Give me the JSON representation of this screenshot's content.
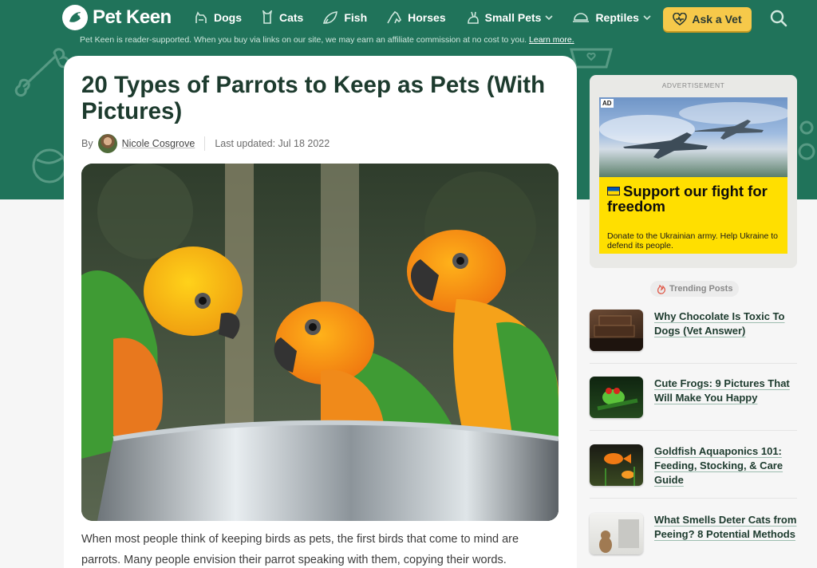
{
  "site": {
    "logo_text": "Pet Keen"
  },
  "nav": {
    "items": [
      {
        "label": "Dogs",
        "icon": "dog-icon"
      },
      {
        "label": "Cats",
        "icon": "cat-icon"
      },
      {
        "label": "Fish",
        "icon": "fish-icon"
      },
      {
        "label": "Horses",
        "icon": "horse-icon"
      },
      {
        "label": "Small Pets",
        "icon": "rabbit-icon",
        "dropdown": true
      },
      {
        "label": "Reptiles",
        "icon": "turtle-icon",
        "dropdown": true
      }
    ],
    "cta_label": "Ask a Vet"
  },
  "disclaimer": {
    "text": "Pet Keen is reader-supported. When you buy via links on our site, we may earn an affiliate commission at no cost to you.",
    "link": "Learn more."
  },
  "article": {
    "title": "20 Types of Parrots to Keep as Pets (With Pictures)",
    "by_label": "By",
    "author": "Nicole Cosgrove",
    "updated": "Last updated: Jul 18 2022",
    "intro": "When most people think of keeping birds as pets, the first birds that come to mind are parrots. Many people envision their parrot speaking with them, copying their words."
  },
  "ad": {
    "label": "ADVERTISEMENT",
    "tag": "AD",
    "headline": "Support our fight for freedom",
    "sub": "Donate to the Ukrainian army. Help Ukraine to defend its people."
  },
  "trending": {
    "label": "Trending Posts",
    "posts": [
      {
        "title": "Why Chocolate Is Toxic To Dogs (Vet Answer)"
      },
      {
        "title": "Cute Frogs: 9 Pictures That Will Make You Happy"
      },
      {
        "title": "Goldfish Aquaponics 101: Feeding, Stocking, & Care Guide"
      },
      {
        "title": "What Smells Deter Cats from Peeing? 8 Potential Methods"
      }
    ]
  },
  "colors": {
    "brand_green": "#20735a",
    "heading": "#1d3b2e",
    "cta_yellow": "#f6c94a"
  }
}
